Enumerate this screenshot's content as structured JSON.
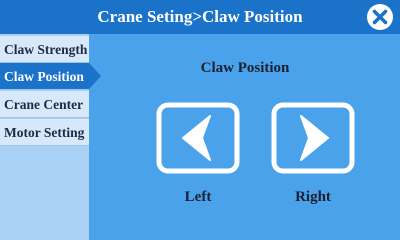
{
  "header": {
    "title": "Crane Seting>Claw Position",
    "close_icon": "close-icon"
  },
  "sidebar": {
    "items": [
      {
        "label": "Claw Strength",
        "active": false
      },
      {
        "label": "Claw Position",
        "active": true
      },
      {
        "label": "Crane Center",
        "active": false
      },
      {
        "label": "Motor Setting",
        "active": false
      }
    ]
  },
  "main": {
    "title": "Claw Position",
    "buttons": [
      {
        "label": "Left",
        "icon": "chevron-left-icon"
      },
      {
        "label": "Right",
        "icon": "chevron-right-icon"
      }
    ]
  },
  "colors": {
    "header_bg": "#1a73c8",
    "content_bg": "#4aa3ea",
    "sidebar_item_bg": "#d6e8fa",
    "sidebar_active_bg": "#1a73c8",
    "text_dark": "#1b1f33",
    "white": "#ffffff"
  }
}
